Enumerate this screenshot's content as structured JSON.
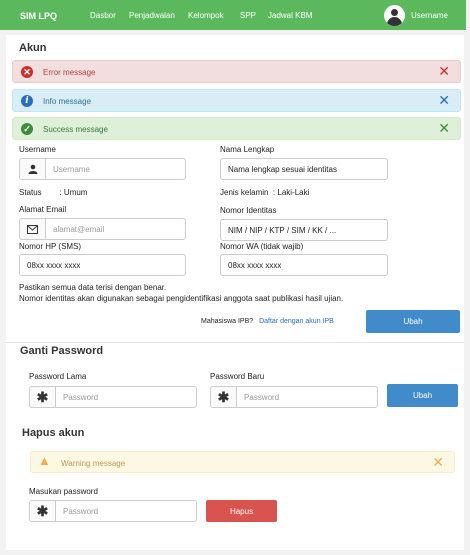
{
  "navbar": {
    "brand": "SIM LPQ",
    "items": [
      "Dasbor",
      "Penjadwalan",
      "Kelompok",
      "SPP",
      "Jadwal KBM"
    ],
    "username": "Username",
    "color": "#5cb85c"
  },
  "account": {
    "title": "Akun",
    "alerts": {
      "error": "Error message",
      "info": "Info message",
      "success": "Success message"
    },
    "username_label": "Username",
    "username_placeholder": "Username",
    "fullname_label": "Nama Lengkap",
    "fullname_value": "Nama lengkap sesuai identitas",
    "status_label": "Status",
    "status_value": ": Umum",
    "gender_label": "Jenis kelamin",
    "gender_value": ": Laki-Laki",
    "email_label": "Alamat Email",
    "email_placeholder": "alamat@email",
    "id_label": "Nomor Identitas",
    "id_value": "NIM / NIP / KTP / SIM / KK / ...",
    "phone_label": "Nomor HP (SMS)",
    "phone_value": "08xx xxxx xxxx",
    "wa_label": "Nomor WA (tidak wajib)",
    "wa_value": "08xx xxxx xxxx",
    "note_line1": "Pastikan semua data terisi dengan benar.",
    "note_line2": "Nomor  identitas akan digunakan sebagai pengidentifikasi anggota saat publikasi hasil ujian.",
    "ipb_question": "Mahasiswa IPB?",
    "ipb_link": "Daftar dengan akun IPB",
    "submit_label": "Ubah"
  },
  "password": {
    "title": "Ganti Password",
    "old_label": "Password Lama",
    "old_placeholder": "Password",
    "new_label": "Password Baru",
    "new_placeholder": "Password",
    "submit_label": "Ubah"
  },
  "delete": {
    "title": "Hapus akun",
    "warning": "Warning message",
    "password_label": "Masukan password",
    "password_placeholder": "Password",
    "submit_label": "Hapus"
  },
  "colors": {
    "primary": "#428bca",
    "danger": "#d9534f",
    "link": "#2a6ebb"
  }
}
